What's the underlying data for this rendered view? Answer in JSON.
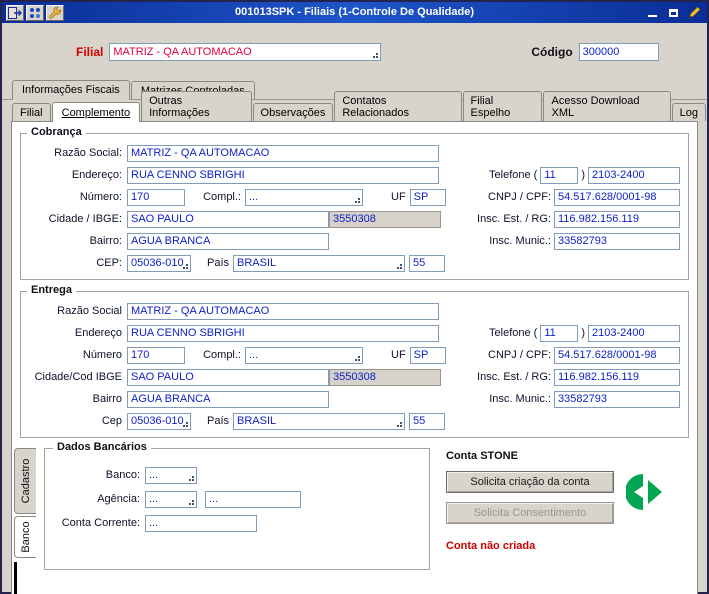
{
  "window": {
    "title": "001013SPK - Filiais (1-Controle De Qualidade)"
  },
  "icons": {
    "exit": "exit-icon",
    "app": "app-grid-icon",
    "wrench": "wrench-icon",
    "minimize": "minimize-icon",
    "maximize": "maximize-icon",
    "pencil": "pencil-icon",
    "stone_logo": "stone-logo-icon",
    "lookup": "lookup-dots-icon"
  },
  "colors": {
    "titlebar_blue": "#0a2d96",
    "window_gray": "#d8d4cc",
    "input_text_blue": "#0a1ec8",
    "filial_label_red": "#d00000",
    "filial_value_red": "#e00040",
    "status_red": "#cc0000",
    "stone_green": "#00a651"
  },
  "header": {
    "filial_label": "Filial",
    "filial_value": "MATRIZ - QA AUTOMACAO",
    "codigo_label": "Código",
    "codigo_value": "300000"
  },
  "top_tabs": {
    "fiscais": "Informações Fiscais",
    "matrizes": "Matrizes Controladas"
  },
  "main_tabs": {
    "filial": "Filial",
    "complemento": "Complemento",
    "outras_informacoes": "Outras Informações",
    "observacoes": "Observações",
    "contatos_relacionados": "Contatos Relacionados",
    "filial_espelho": "Filial Espelho",
    "acesso_download_xml": "Acesso Download XML",
    "log": "Log"
  },
  "cobranca": {
    "title": "Cobrança",
    "razao_label": "Razão Social:",
    "razao_value": "MATRIZ - QA AUTOMACAO",
    "endereco_label": "Endereço:",
    "endereco_value": "RUA CENNO SBRIGHI",
    "numero_label": "Número:",
    "numero_value": "170",
    "compl_label": "Compl.:",
    "compl_value": "...",
    "uf_label": "UF",
    "uf_value": "SP",
    "cidade_label": "Cidade / IBGE:",
    "cidade_value": "SAO PAULO",
    "ibge_value": "3550308",
    "bairro_label": "Bairro:",
    "bairro_value": "AGUA BRANCA",
    "cep_label": "CEP:",
    "cep_value": "05036-010",
    "pais_label": "País",
    "pais_value": "BRASIL",
    "ddi_value": "55",
    "telefone_label_open": "Telefone (",
    "telefone_label_close": ")",
    "telefone_ddd": "11",
    "telefone_numero": "2103-2400",
    "cnpj_label": "CNPJ / CPF:",
    "cnpj_value": "54.517.628/0001-98",
    "insc_est_label": "Insc. Est. / RG:",
    "insc_est_value": "116.982.156.119",
    "insc_mun_label": "Insc. Munic.:",
    "insc_mun_value": "33582793"
  },
  "entrega": {
    "title": "Entrega",
    "razao_label": "Razão Social",
    "razao_value": "MATRIZ - QA AUTOMACAO",
    "endereco_label": "Endereço",
    "endereco_value": "RUA CENNO SBRIGHI",
    "numero_label": "Número",
    "numero_value": "170",
    "compl_label": "Compl.:",
    "compl_value": "...",
    "uf_label": "UF",
    "uf_value": "SP",
    "cidade_label": "Cidade/Cod IBGE",
    "cidade_value": "SAO PAULO",
    "ibge_value": "3550308",
    "bairro_label": "Bairro",
    "bairro_value": "AGUA BRANCA",
    "cep_label": "Cep",
    "cep_value": "05036-010",
    "pais_label": "País",
    "pais_value": "BRASIL",
    "ddi_value": "55",
    "telefone_label_open": "Telefone (",
    "telefone_label_close": ")",
    "telefone_ddd": "11",
    "telefone_numero": "2103-2400",
    "cnpj_label": "CNPJ / CPF:",
    "cnpj_value": "54.517.628/0001-98",
    "insc_est_label": "Insc. Est. / RG:",
    "insc_est_value": "116.982.156.119",
    "insc_mun_label": "Insc. Munic.:",
    "insc_mun_value": "33582793"
  },
  "side_tabs": {
    "cadastro": "Cadastro",
    "banco": "Banco"
  },
  "dados_bancarios": {
    "title": "Dados Bancários",
    "banco_label": "Banco:",
    "banco_value": "...",
    "agencia_label": "Agência:",
    "agencia_value": "...",
    "agencia_value2": "...",
    "conta_label": "Conta Corrente:",
    "conta_value": "..."
  },
  "conta_stone": {
    "title": "Conta STONE",
    "botao_criacao": "Solicita criação da conta",
    "botao_consentimento": "Solicita Consentimento",
    "status": "Conta não criada"
  }
}
